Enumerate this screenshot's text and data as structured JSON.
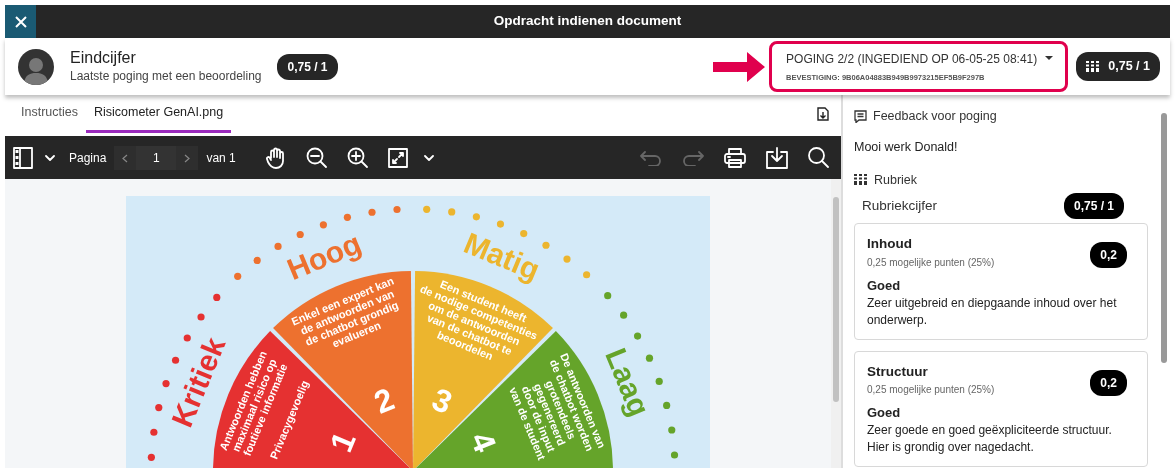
{
  "dialog": {
    "title": "Opdracht indienen document"
  },
  "grade": {
    "title": "Eindcijfer",
    "subtitle": "Laatste poging met een beoordeling",
    "score": "0,75 / 1"
  },
  "attempt": {
    "label": "POGING 2/2 (INGEDIEND OP 06-05-25 08:41)",
    "confirmation": "BEVESTIGING: 9B06A04883B949B9973215EF5B9F297B",
    "score": "0,75 / 1",
    "highlighted": true
  },
  "tabs": [
    {
      "label": "Instructies",
      "selected": false
    },
    {
      "label": "Risicometer GenAI.png",
      "selected": true
    }
  ],
  "viewer_toolbar": {
    "page_label": "Pagina",
    "page": "1",
    "page_total": "van 1",
    "prev_disabled": true,
    "next_disabled": true,
    "tools_left": [
      {
        "kind": "hand",
        "disabled": false
      },
      {
        "kind": "zoom-out",
        "disabled": false
      },
      {
        "kind": "zoom-in",
        "disabled": false
      },
      {
        "kind": "fit",
        "disabled": false
      }
    ],
    "tools_right": [
      {
        "kind": "undo",
        "disabled": true
      },
      {
        "kind": "redo",
        "disabled": true
      },
      {
        "kind": "print",
        "disabled": false
      },
      {
        "kind": "download",
        "disabled": false
      },
      {
        "kind": "search",
        "disabled": false
      }
    ]
  },
  "image": {
    "segments": [
      {
        "label": "Kritiek",
        "number": "1",
        "color": "#e53131",
        "lines": [
          "Antwoorden hebben",
          "maximaal risico op",
          "foutieve informatie"
        ],
        "note": "Privacygevoelig"
      },
      {
        "label": "Hoog",
        "number": "2",
        "color": "#ed712f",
        "lines": [
          "Enkel een expert kan",
          "de antwoorden van",
          "de chatbot grondig",
          "evalueren"
        ]
      },
      {
        "label": "Matig",
        "number": "3",
        "color": "#ecb52e",
        "lines": [
          "Een student heeft",
          "de nodige competenties",
          "om de antwoorden",
          "van de chatbot te",
          "beoordelen"
        ]
      },
      {
        "label": "Laag",
        "number": "4",
        "color": "#65a42a",
        "lines": [
          "De antwoorden van",
          "de chatbot worden",
          "grotendeels",
          "gegenereerd",
          "door de input",
          "van de student"
        ]
      }
    ]
  },
  "feedback": {
    "title": "Feedback voor poging",
    "text": "Mooi werk Donald!"
  },
  "rubric": {
    "title": "Rubriek",
    "score_label": "Rubriekcijfer",
    "score": "0,75 / 1",
    "criteria": [
      {
        "name": "Inhoud",
        "possible": "0,25 mogelijke punten (25%)",
        "score": "0,2",
        "level": "Goed",
        "description": "Zeer uitgebreid en diepgaande inhoud over het onderwerp."
      },
      {
        "name": "Structuur",
        "possible": "0,25 mogelijke punten (25%)",
        "score": "0,2",
        "level": "Goed",
        "description": "Zeer goede en goed geëxpliciteerde structuur. Hier is grondig over nagedacht."
      }
    ]
  }
}
